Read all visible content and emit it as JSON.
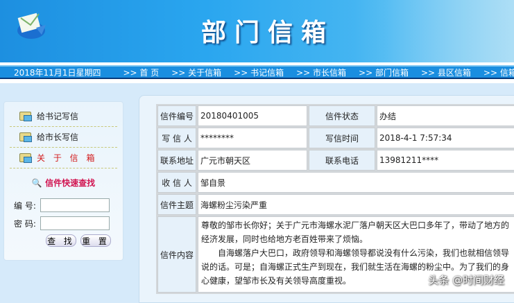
{
  "header": {
    "title": "部门信箱"
  },
  "nav": {
    "date": "2018年11月1日星期四",
    "items": [
      ">> 首 页",
      ">> 关于信箱",
      ">> 书记信箱",
      ">> 市长信箱",
      ">> 部门信箱",
      ">> 县区信箱",
      ">> 信箱中心"
    ]
  },
  "sidebar": {
    "items": [
      "给书记写信",
      "给市长写信",
      "关 于 信 箱"
    ],
    "search_title": "信件快速查找",
    "id_label": "编 号:",
    "pwd_label": "密 码:",
    "search_btn": "查 找",
    "reset_btn": "重 置"
  },
  "letter": {
    "id_label": "信件编号",
    "id": "20180401005",
    "status_label": "信件状态",
    "status": "办结",
    "writer_label": "写 信 人",
    "writer": "********",
    "time_label": "写信时间",
    "time": "2018-4-1 7:57:34",
    "addr_label": "联系地址",
    "addr": "广元市朝天区",
    "phone_label": "联系电话",
    "phone": "13981211****",
    "recipient_label": "收 信 人",
    "recipient": "邹自景",
    "subject_label": "信件主题",
    "subject": "海螺粉尘污染严重",
    "content_label": "信件内容",
    "content_p1": "尊敬的邹市长你好；关于广元市海螺水泥厂落户朝天区大巴口多年了，带动了地方的经济发展，同时也给地方老百姓带来了烦恼。",
    "content_p2": "自海螺落户大巴口，政府领导和海螺领导都说没有什么污染，我们也就相信领导说的话。可是；自海螺正式生产到现在，我们就生活在海螺的粉尘中。为了我们的身心健康，望邹市长及有关领导高度重视。"
  },
  "watermark": "头条 @时间财经"
}
